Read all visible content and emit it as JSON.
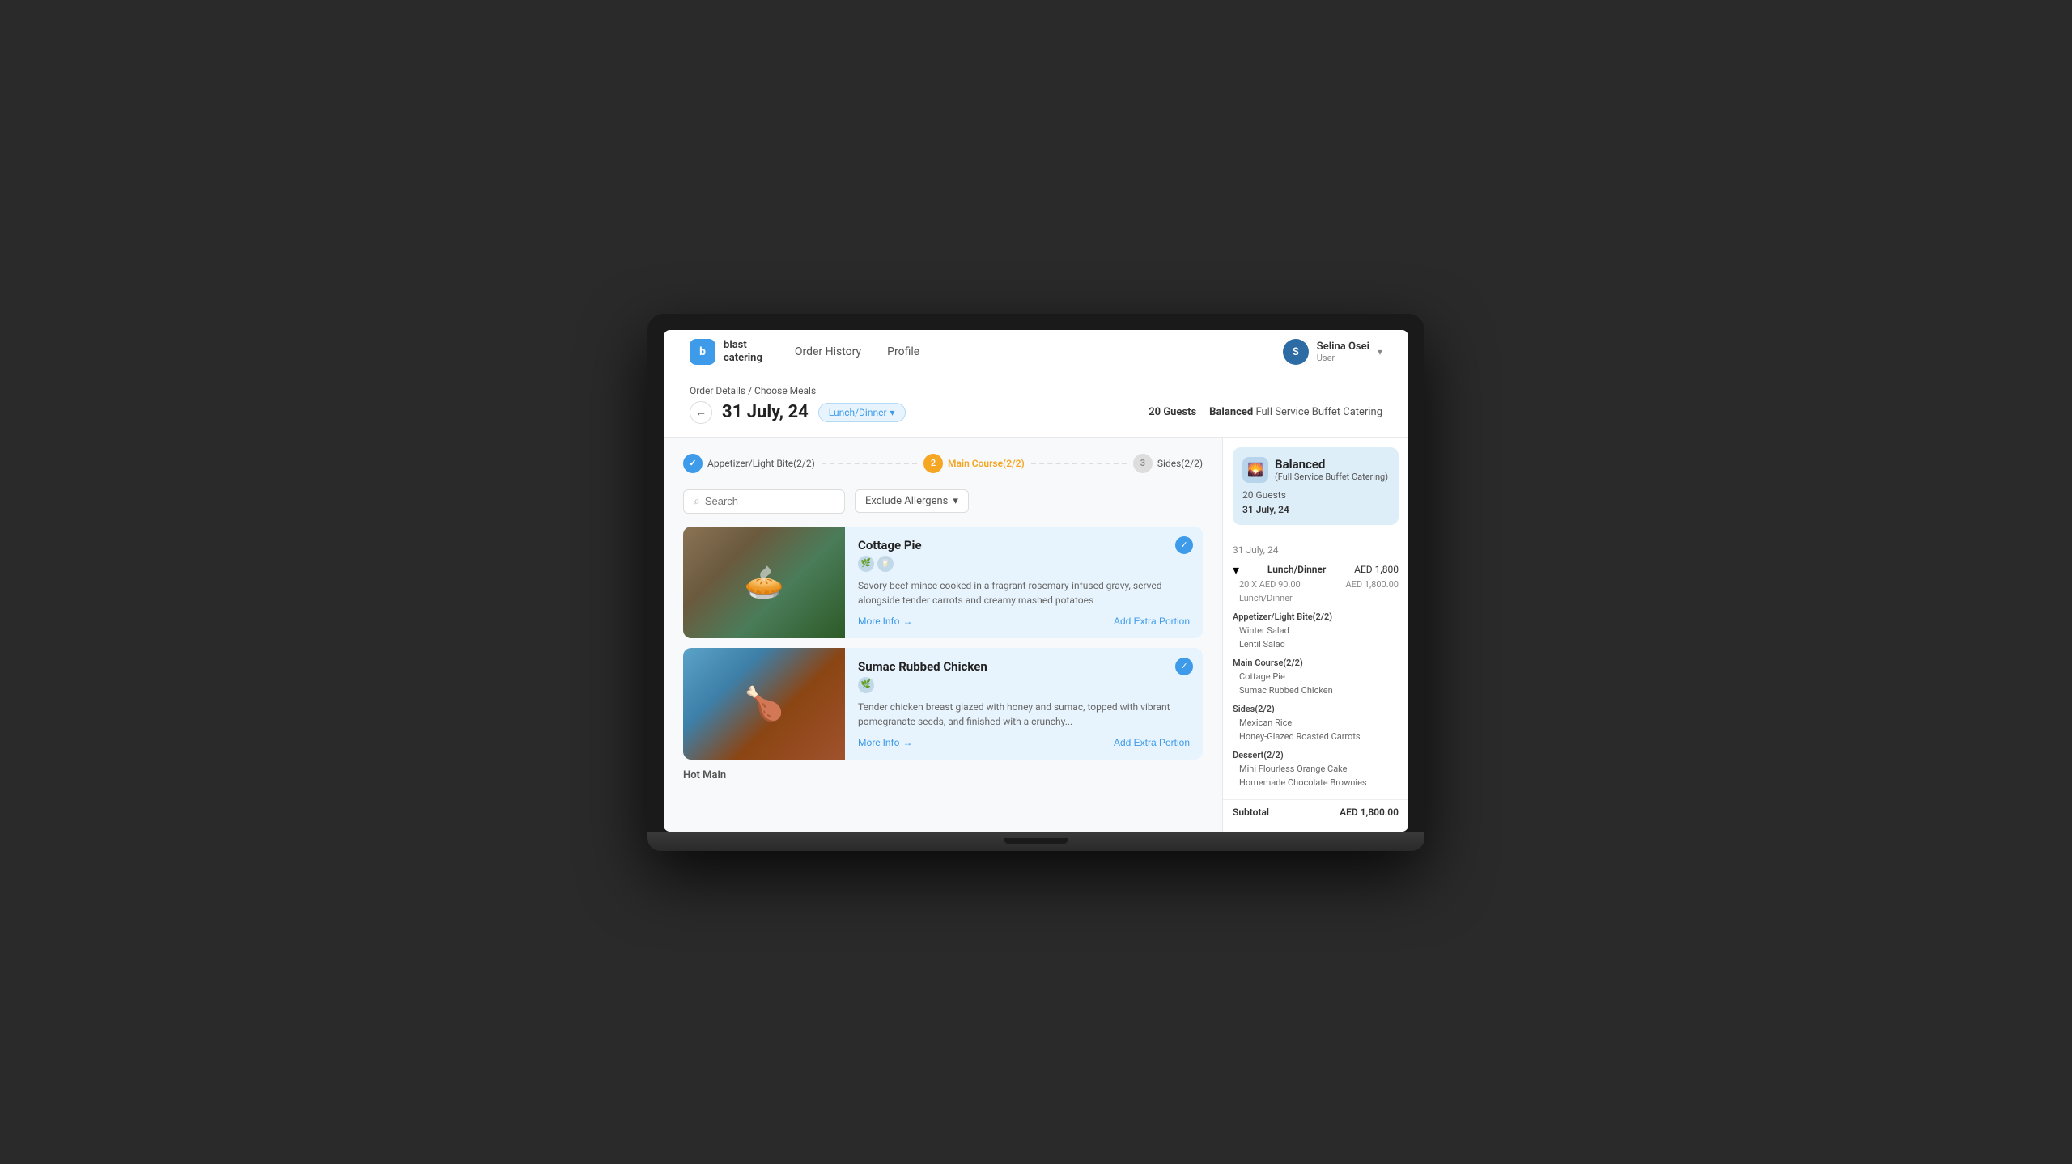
{
  "app": {
    "logo_letter": "b",
    "brand_name_line1": "blast",
    "brand_name_line2": "catering"
  },
  "nav": {
    "links": [
      {
        "id": "order-history",
        "label": "Order History",
        "active": false
      },
      {
        "id": "profile",
        "label": "Profile",
        "active": false
      }
    ]
  },
  "user": {
    "name": "Selina Osei",
    "role": "User",
    "initials": "S"
  },
  "breadcrumb": {
    "part1": "Order Details",
    "separator": "/",
    "part2": "Choose Meals"
  },
  "page": {
    "date": "31 July, 24",
    "meal_type": "Lunch/Dinner",
    "guests_label": "20 Guests",
    "catering_type_bold": "Balanced",
    "catering_type_rest": "Full Service Buffet Catering"
  },
  "steps": [
    {
      "id": "step1",
      "number": "✓",
      "label": "Appetizer/Light Bite(2/2)",
      "state": "completed"
    },
    {
      "id": "step2",
      "number": "2",
      "label": "Main Course(2/2)",
      "state": "active"
    },
    {
      "id": "step3",
      "number": "3",
      "label": "Sides(2/2)",
      "state": "inactive"
    }
  ],
  "search": {
    "placeholder": "Search",
    "allergen_label": "Exclude Allergens"
  },
  "meals": [
    {
      "id": "cottage-pie",
      "title": "Cottage Pie",
      "description": "Savory beef mince cooked in a fragrant rosemary-infused gravy, served alongside tender carrots and creamy mashed potatoes",
      "more_info": "More Info",
      "add_extra": "Add Extra Portion",
      "selected": true,
      "icons": [
        "🌿",
        "🥛"
      ]
    },
    {
      "id": "sumac-chicken",
      "title": "Sumac Rubbed Chicken",
      "description": "Tender chicken breast glazed with honey and sumac, topped with vibrant pomegranate seeds, and finished with a crunchy...",
      "more_info": "More Info",
      "add_extra": "Add Extra Portion",
      "selected": true,
      "icons": [
        "🌿"
      ]
    }
  ],
  "section_label": "Hot Main",
  "order_summary": {
    "title": "Balanced",
    "subtitle": "(Full Service Buffet Catering)",
    "guests": "20 Guests",
    "date": "31 July, 24",
    "order_date": "31 July, 24",
    "section_title": "Lunch/Dinner",
    "section_amount": "AED 1,800",
    "price_per_head": "20 X AED 90.00",
    "price_label": "Lunch/Dinner",
    "total_price": "AED 1,800.00",
    "categories": [
      {
        "name": "Appetizer/Light Bite(2/2)",
        "items": [
          "Winter Salad",
          "Lentil Salad"
        ]
      },
      {
        "name": "Main Course(2/2)",
        "items": [
          "Cottage Pie",
          "Sumac Rubbed Chicken"
        ]
      },
      {
        "name": "Sides(2/2)",
        "items": [
          "Mexican Rice",
          "Honey-Glazed Roasted Carrots"
        ]
      },
      {
        "name": "Dessert(2/2)",
        "items": [
          "Mini Flourless Orange Cake",
          "Homemade Chocolate Brownies"
        ]
      }
    ],
    "subtotal_label": "Subtotal",
    "subtotal_amount": "AED 1,800.00"
  },
  "icons": {
    "back": "←",
    "chevron_down": "▾",
    "check": "✓",
    "arrow_right": "→",
    "search": "🔍",
    "dropdown_arrow": "▾"
  }
}
